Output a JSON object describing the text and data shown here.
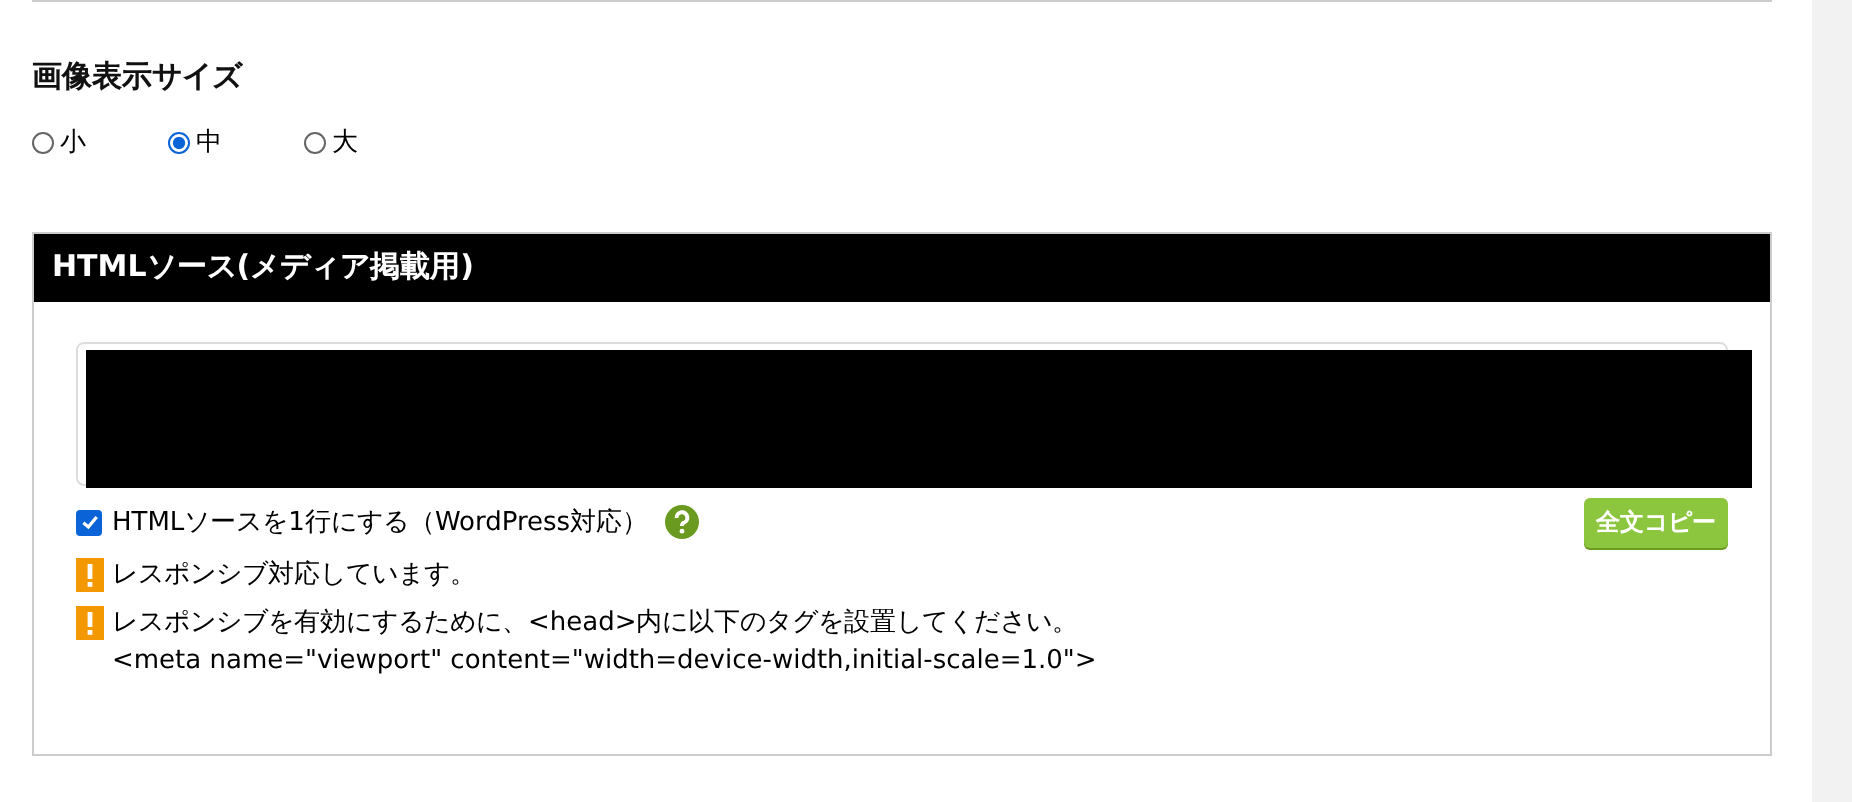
{
  "size_section": {
    "title": "画像表示サイズ",
    "options": [
      {
        "label": "小",
        "selected": false
      },
      {
        "label": "中",
        "selected": true
      },
      {
        "label": "大",
        "selected": false
      }
    ]
  },
  "source_panel": {
    "title": "HTMLソース(メディア掲載用)",
    "redacted": true,
    "one_line_option": {
      "label": "HTMLソースを1行にする（WordPress対応）",
      "checked": true
    },
    "copy_button": "全文コピー",
    "notices": [
      {
        "lines": [
          "レスポンシブ対応しています。"
        ]
      },
      {
        "lines": [
          "レスポンシブを有効にするために、<head>内に以下のタグを設置してください。",
          "<meta name=\"viewport\" content=\"width=device-width,initial-scale=1.0\">"
        ]
      }
    ]
  }
}
